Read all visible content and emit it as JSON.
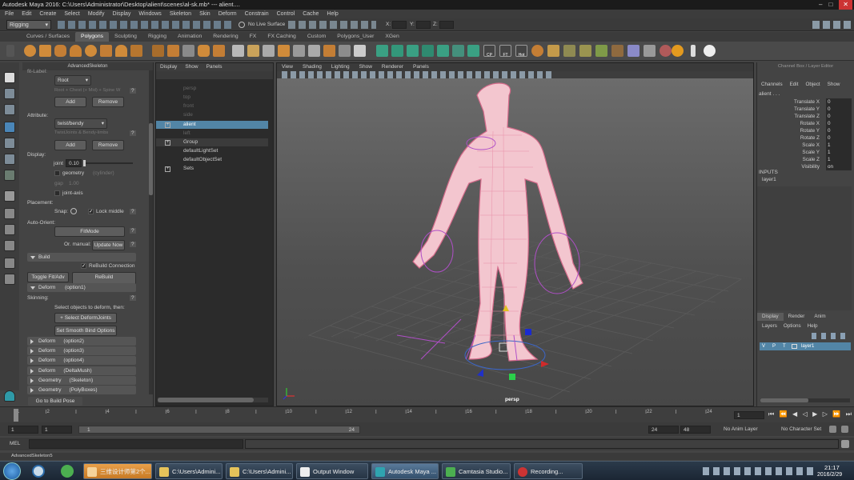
{
  "window": {
    "title": "Autodesk Maya 2016: C:\\Users\\Administrator\\Desktop\\alient\\scenes\\al-sk.mb*  ---  alient...."
  },
  "menus": [
    "File",
    "Edit",
    "Create",
    "Select",
    "Modify",
    "Display",
    "Windows",
    "Skeleton",
    "Skin",
    "Deform",
    "Constrain",
    "Control",
    "Cache",
    "Help"
  ],
  "status": {
    "mode": "Rigging",
    "live": "No Live Surface",
    "x": "X:",
    "y": "Y:",
    "z": "Z:"
  },
  "shelf_tabs": [
    "Curves / Surfaces",
    "Polygons",
    "Sculpting",
    "Rigging",
    "Animation",
    "Rendering",
    "FX",
    "FX Caching",
    "Custom",
    "Polygons_User",
    "XGen"
  ],
  "shelf_labels": {
    "cp": "CP",
    "ft": "FT",
    "hot": "Hot"
  },
  "ae": {
    "title": "AdvancedSkeleton",
    "fit_label": "fit-Label:",
    "root": "Root",
    "root_hint": "Root + Chest (+ Mid) + Spine W",
    "add": "Add",
    "remove": "Remove",
    "attribute": "Attribute:",
    "attr_value": "twist/bendy",
    "attr_hint": "TwistJoints & Bendy-limbs",
    "display": "Display:",
    "joint": "joint",
    "joint_val": "0.10",
    "geometry": "geometry",
    "geometry_val": "(cylinder)",
    "gap": "gap",
    "gap_val": "1.00",
    "joint_axis": "joint-axis",
    "placement": "Placement:",
    "snap": "Snap:",
    "lock_middle": "Lock middle",
    "auto_orient": "Auto-Orient:",
    "fitmode": "FitMode",
    "orient_manual": "Or. manual:",
    "update_now": "Update Now",
    "build": "Build",
    "rebuild_conn": "ReBuild Connection",
    "toggle_fit": "Toggle Fit/Adv",
    "rebuild_adv": "ReBuild AdvancedSkeleton",
    "deform": "Deform",
    "deform_opt": "(option1)",
    "skinning": "Skinning:",
    "select_hint": "Select objects to deform, then:",
    "select_deform": "+ Select DeformJoints",
    "smooth_bind": "Set Smooth Bind Options",
    "sections": [
      {
        "name": "Deform",
        "opt": "(option2)"
      },
      {
        "name": "Deform",
        "opt": "(option3)"
      },
      {
        "name": "Deform",
        "opt": "(option4)"
      },
      {
        "name": "Deform",
        "opt": "(DeltaMush)"
      },
      {
        "name": "Geometry",
        "opt": "(Skeleton)"
      },
      {
        "name": "Geometry",
        "opt": "(PolyBoxes)"
      }
    ],
    "build_pose": "Go to Build Pose",
    "help": "?"
  },
  "outliner": {
    "menus": [
      "Display",
      "Show",
      "Panels"
    ],
    "items": [
      {
        "name": "persp",
        "dim": true
      },
      {
        "name": "top",
        "dim": true
      },
      {
        "name": "front",
        "dim": true
      },
      {
        "name": "side",
        "dim": true
      },
      {
        "name": "alient",
        "dim": false,
        "selected": true
      },
      {
        "name": "left",
        "dim": true
      },
      {
        "name": "Group",
        "dim": false
      },
      {
        "name": "defaultLightSet",
        "dim": false
      },
      {
        "name": "defaultObjectSet",
        "dim": false
      },
      {
        "name": "Sets",
        "dim": false
      }
    ]
  },
  "viewport": {
    "menus": [
      "View",
      "Shading",
      "Lighting",
      "Show",
      "Renderer",
      "Panels"
    ],
    "camera": "persp"
  },
  "channel_box": {
    "title": "Channel Box / Layer Editor",
    "menus": [
      "Channels",
      "Edit",
      "Object",
      "Show"
    ],
    "object": "alient . . .",
    "channels": [
      {
        "name": "Translate X",
        "value": "0"
      },
      {
        "name": "Translate Y",
        "value": "0"
      },
      {
        "name": "Translate Z",
        "value": "0"
      },
      {
        "name": "Rotate X",
        "value": "0"
      },
      {
        "name": "Rotate Y",
        "value": "0"
      },
      {
        "name": "Rotate Z",
        "value": "0"
      },
      {
        "name": "Scale X",
        "value": "1"
      },
      {
        "name": "Scale Y",
        "value": "1"
      },
      {
        "name": "Scale Z",
        "value": "1"
      },
      {
        "name": "Visibility",
        "value": "on"
      }
    ],
    "inputs": "INPUTS",
    "input_item": "layer1",
    "layer_tabs": [
      "Display",
      "Render",
      "Anim"
    ],
    "layer_menus": [
      "Layers",
      "Options",
      "Help"
    ],
    "layer": {
      "v": "V",
      "p": "P",
      "t": "T",
      "name": "layer1"
    }
  },
  "timeline": {
    "ticks": [
      "1",
      "2",
      "4",
      "6",
      "8",
      "10",
      "12",
      "14",
      "16",
      "18",
      "20",
      "22",
      "24"
    ],
    "current": "1",
    "start": "1",
    "range_start": "1",
    "range_frame": "1",
    "range_end": "24",
    "end": "24",
    "max": "48",
    "anim_layer": "No Anim Layer",
    "char_set": "No Character Set"
  },
  "mel": "MEL",
  "helpline": "AdvancedSkeleton5",
  "taskbar": {
    "items": [
      "三维设计师第2个...",
      "C:\\Users\\Admini...",
      "C:\\Users\\Admini...",
      "Output Window",
      "Autodesk Maya ...",
      "Camtasia Studio...",
      "Recording..."
    ],
    "time": "21:17",
    "date": "2016/2/29"
  }
}
